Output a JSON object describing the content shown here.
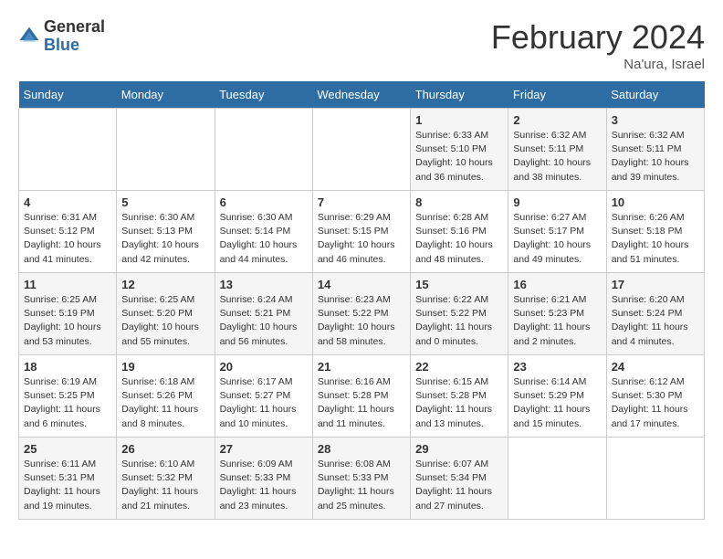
{
  "logo": {
    "general": "General",
    "blue": "Blue"
  },
  "title": "February 2024",
  "location": "Na'ura, Israel",
  "weekdays": [
    "Sunday",
    "Monday",
    "Tuesday",
    "Wednesday",
    "Thursday",
    "Friday",
    "Saturday"
  ],
  "weeks": [
    [
      {
        "day": "",
        "sunrise": "",
        "sunset": "",
        "daylight": ""
      },
      {
        "day": "",
        "sunrise": "",
        "sunset": "",
        "daylight": ""
      },
      {
        "day": "",
        "sunrise": "",
        "sunset": "",
        "daylight": ""
      },
      {
        "day": "",
        "sunrise": "",
        "sunset": "",
        "daylight": ""
      },
      {
        "day": "1",
        "sunrise": "Sunrise: 6:33 AM",
        "sunset": "Sunset: 5:10 PM",
        "daylight": "Daylight: 10 hours and 36 minutes."
      },
      {
        "day": "2",
        "sunrise": "Sunrise: 6:32 AM",
        "sunset": "Sunset: 5:11 PM",
        "daylight": "Daylight: 10 hours and 38 minutes."
      },
      {
        "day": "3",
        "sunrise": "Sunrise: 6:32 AM",
        "sunset": "Sunset: 5:11 PM",
        "daylight": "Daylight: 10 hours and 39 minutes."
      }
    ],
    [
      {
        "day": "4",
        "sunrise": "Sunrise: 6:31 AM",
        "sunset": "Sunset: 5:12 PM",
        "daylight": "Daylight: 10 hours and 41 minutes."
      },
      {
        "day": "5",
        "sunrise": "Sunrise: 6:30 AM",
        "sunset": "Sunset: 5:13 PM",
        "daylight": "Daylight: 10 hours and 42 minutes."
      },
      {
        "day": "6",
        "sunrise": "Sunrise: 6:30 AM",
        "sunset": "Sunset: 5:14 PM",
        "daylight": "Daylight: 10 hours and 44 minutes."
      },
      {
        "day": "7",
        "sunrise": "Sunrise: 6:29 AM",
        "sunset": "Sunset: 5:15 PM",
        "daylight": "Daylight: 10 hours and 46 minutes."
      },
      {
        "day": "8",
        "sunrise": "Sunrise: 6:28 AM",
        "sunset": "Sunset: 5:16 PM",
        "daylight": "Daylight: 10 hours and 48 minutes."
      },
      {
        "day": "9",
        "sunrise": "Sunrise: 6:27 AM",
        "sunset": "Sunset: 5:17 PM",
        "daylight": "Daylight: 10 hours and 49 minutes."
      },
      {
        "day": "10",
        "sunrise": "Sunrise: 6:26 AM",
        "sunset": "Sunset: 5:18 PM",
        "daylight": "Daylight: 10 hours and 51 minutes."
      }
    ],
    [
      {
        "day": "11",
        "sunrise": "Sunrise: 6:25 AM",
        "sunset": "Sunset: 5:19 PM",
        "daylight": "Daylight: 10 hours and 53 minutes."
      },
      {
        "day": "12",
        "sunrise": "Sunrise: 6:25 AM",
        "sunset": "Sunset: 5:20 PM",
        "daylight": "Daylight: 10 hours and 55 minutes."
      },
      {
        "day": "13",
        "sunrise": "Sunrise: 6:24 AM",
        "sunset": "Sunset: 5:21 PM",
        "daylight": "Daylight: 10 hours and 56 minutes."
      },
      {
        "day": "14",
        "sunrise": "Sunrise: 6:23 AM",
        "sunset": "Sunset: 5:22 PM",
        "daylight": "Daylight: 10 hours and 58 minutes."
      },
      {
        "day": "15",
        "sunrise": "Sunrise: 6:22 AM",
        "sunset": "Sunset: 5:22 PM",
        "daylight": "Daylight: 11 hours and 0 minutes."
      },
      {
        "day": "16",
        "sunrise": "Sunrise: 6:21 AM",
        "sunset": "Sunset: 5:23 PM",
        "daylight": "Daylight: 11 hours and 2 minutes."
      },
      {
        "day": "17",
        "sunrise": "Sunrise: 6:20 AM",
        "sunset": "Sunset: 5:24 PM",
        "daylight": "Daylight: 11 hours and 4 minutes."
      }
    ],
    [
      {
        "day": "18",
        "sunrise": "Sunrise: 6:19 AM",
        "sunset": "Sunset: 5:25 PM",
        "daylight": "Daylight: 11 hours and 6 minutes."
      },
      {
        "day": "19",
        "sunrise": "Sunrise: 6:18 AM",
        "sunset": "Sunset: 5:26 PM",
        "daylight": "Daylight: 11 hours and 8 minutes."
      },
      {
        "day": "20",
        "sunrise": "Sunrise: 6:17 AM",
        "sunset": "Sunset: 5:27 PM",
        "daylight": "Daylight: 11 hours and 10 minutes."
      },
      {
        "day": "21",
        "sunrise": "Sunrise: 6:16 AM",
        "sunset": "Sunset: 5:28 PM",
        "daylight": "Daylight: 11 hours and 11 minutes."
      },
      {
        "day": "22",
        "sunrise": "Sunrise: 6:15 AM",
        "sunset": "Sunset: 5:28 PM",
        "daylight": "Daylight: 11 hours and 13 minutes."
      },
      {
        "day": "23",
        "sunrise": "Sunrise: 6:14 AM",
        "sunset": "Sunset: 5:29 PM",
        "daylight": "Daylight: 11 hours and 15 minutes."
      },
      {
        "day": "24",
        "sunrise": "Sunrise: 6:12 AM",
        "sunset": "Sunset: 5:30 PM",
        "daylight": "Daylight: 11 hours and 17 minutes."
      }
    ],
    [
      {
        "day": "25",
        "sunrise": "Sunrise: 6:11 AM",
        "sunset": "Sunset: 5:31 PM",
        "daylight": "Daylight: 11 hours and 19 minutes."
      },
      {
        "day": "26",
        "sunrise": "Sunrise: 6:10 AM",
        "sunset": "Sunset: 5:32 PM",
        "daylight": "Daylight: 11 hours and 21 minutes."
      },
      {
        "day": "27",
        "sunrise": "Sunrise: 6:09 AM",
        "sunset": "Sunset: 5:33 PM",
        "daylight": "Daylight: 11 hours and 23 minutes."
      },
      {
        "day": "28",
        "sunrise": "Sunrise: 6:08 AM",
        "sunset": "Sunset: 5:33 PM",
        "daylight": "Daylight: 11 hours and 25 minutes."
      },
      {
        "day": "29",
        "sunrise": "Sunrise: 6:07 AM",
        "sunset": "Sunset: 5:34 PM",
        "daylight": "Daylight: 11 hours and 27 minutes."
      },
      {
        "day": "",
        "sunrise": "",
        "sunset": "",
        "daylight": ""
      },
      {
        "day": "",
        "sunrise": "",
        "sunset": "",
        "daylight": ""
      }
    ]
  ]
}
